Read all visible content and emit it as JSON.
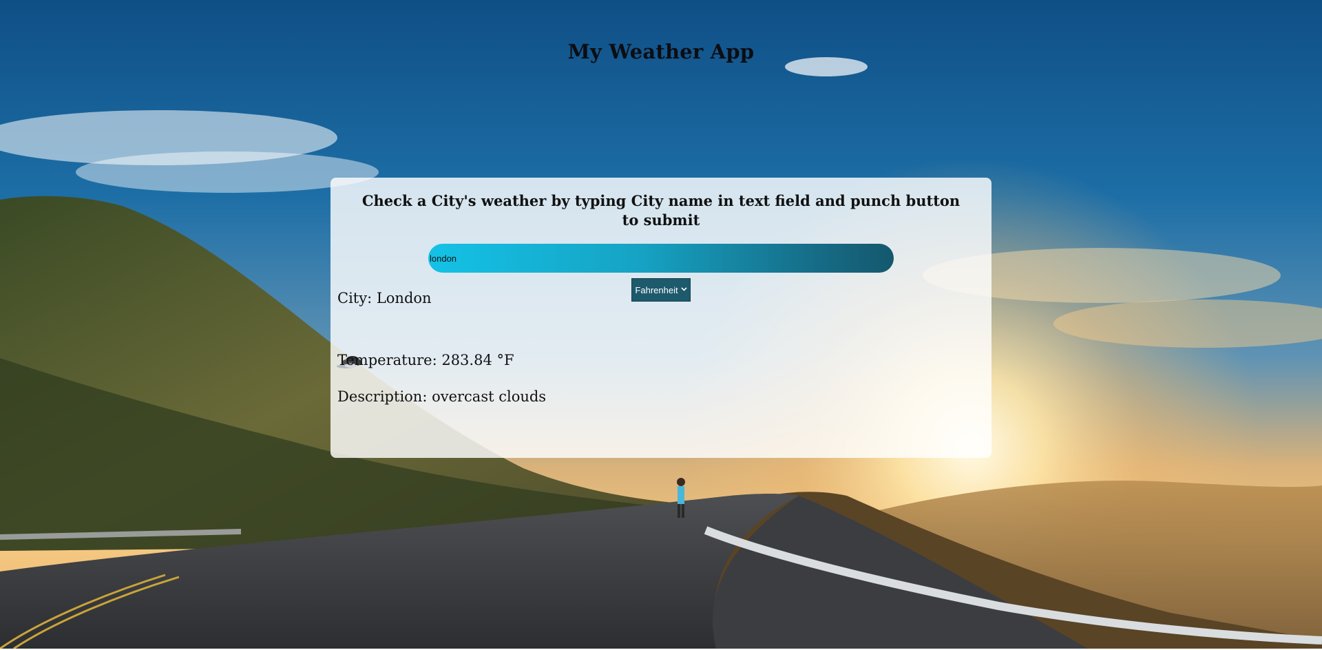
{
  "app": {
    "title": "My Weather App"
  },
  "card": {
    "heading": "Check a City's weather by typing City name in text field and punch button to submit",
    "search": {
      "value": "london",
      "placeholder": ""
    },
    "unit_select": {
      "selected": "Fahrenheit"
    },
    "weather": {
      "city": "City: London",
      "icon": "overcast-clouds-icon",
      "temperature": "Temperature: 283.84 °F",
      "description": "Description: overcast clouds"
    }
  },
  "colors": {
    "input_gradient_start": "#14c2e6",
    "input_gradient_end": "#14586d",
    "select_bg": "#1d5a6c",
    "card_bg": "rgba(255,255,255,0.82)"
  }
}
